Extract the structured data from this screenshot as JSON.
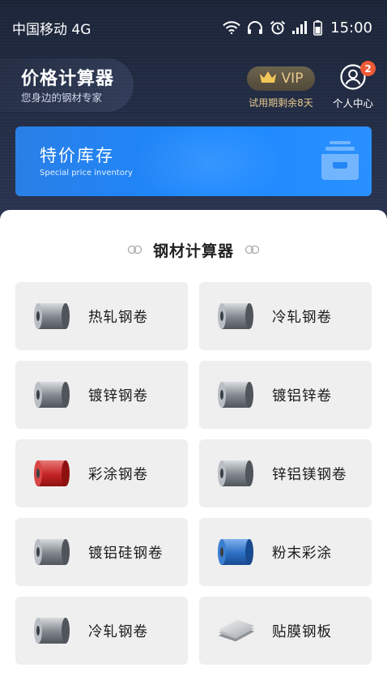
{
  "status_bar": {
    "carrier": "中国移动 4G",
    "time": "15:00"
  },
  "header": {
    "title": "价格计算器",
    "subtitle": "您身边的钢材专家",
    "vip_label": "VIP",
    "trial_text": "试用期剩余8天",
    "profile_label": "个人中心",
    "notification_count": "2"
  },
  "banner": {
    "title": "特价库存",
    "subtitle": "Special price inventory"
  },
  "section": {
    "title": "钢材计算器"
  },
  "items": [
    {
      "label": "热轧钢卷",
      "icon": "steel-coil-silver-icon"
    },
    {
      "label": "冷轧钢卷",
      "icon": "steel-coil-silver-icon"
    },
    {
      "label": "镀锌钢卷",
      "icon": "steel-coil-silver-icon"
    },
    {
      "label": "镀铝锌卷",
      "icon": "steel-coil-silver-icon"
    },
    {
      "label": "彩涂钢卷",
      "icon": "steel-coil-red-icon"
    },
    {
      "label": "锌铝镁钢卷",
      "icon": "steel-coil-silver-icon"
    },
    {
      "label": "镀铝硅钢卷",
      "icon": "steel-coil-silver-icon"
    },
    {
      "label": "粉末彩涂",
      "icon": "steel-coil-blue-icon"
    },
    {
      "label": "冷轧钢卷",
      "icon": "steel-coil-silver-icon"
    },
    {
      "label": "贴膜钢板",
      "icon": "steel-sheet-stack-icon"
    }
  ],
  "colors": {
    "header_bg": "#222c44",
    "banner_blue": "#1b88ff",
    "vip_gold": "#e7c98a",
    "badge_red": "#f05a36",
    "card_bg": "#efefef"
  }
}
